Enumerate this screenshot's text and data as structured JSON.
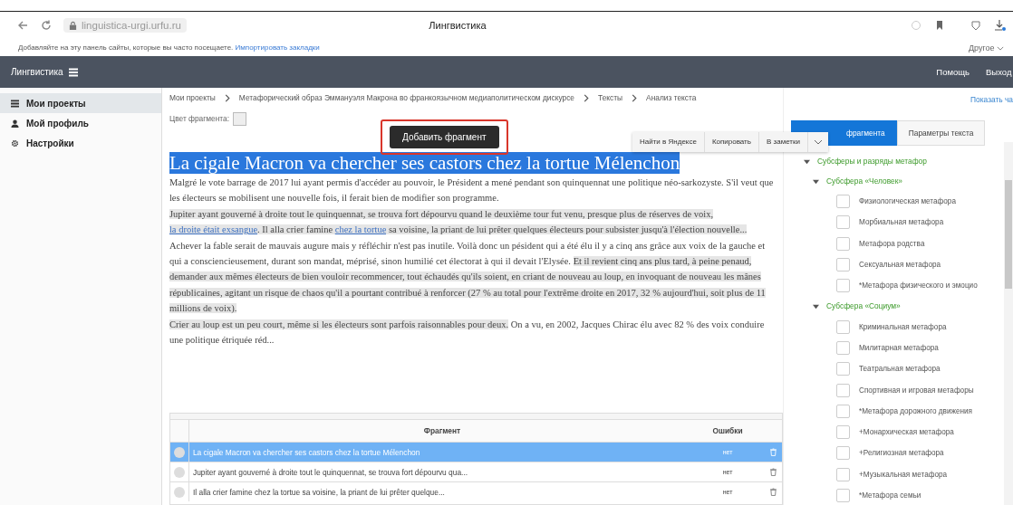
{
  "browser": {
    "url": "linguistica-urgi.urfu.ru",
    "title": "Лингвистика",
    "bookmarks_hint": "Добавляйте на эту панель сайты, которые вы часто посещаете.",
    "bookmarks_link": "Импортировать закладки",
    "other": "Другое"
  },
  "navbar": {
    "brand": "Лингвистика",
    "links": [
      "Помощь",
      "Выход"
    ]
  },
  "sidebar": {
    "items": [
      {
        "label": "Мои проекты",
        "kind": "list",
        "selected": true
      },
      {
        "label": "Мой профиль",
        "kind": "user",
        "selected": false
      },
      {
        "label": "Настройки",
        "kind": "gear",
        "selected": false
      }
    ]
  },
  "breadcrumbs": [
    "Мои проекты",
    "Метафорический образ Эммануэля Макрона во франкоязычном медиаполитическом дискурсе",
    "Тексты",
    "Анализ текста"
  ],
  "show_link": "Показать ча",
  "fragment_color_label": "Цвет фрагмента:",
  "tooltip": "Добавить фрагмент",
  "context_menu": [
    "Найти в Яндексе",
    "Копировать",
    "В заметки"
  ],
  "tabs": [
    {
      "label": "фрагмента",
      "selected": true
    },
    {
      "label": "Параметры текста",
      "selected": false
    }
  ],
  "document": {
    "title": "La cigale Macron va chercher ses castors chez la tortue Mélenchon",
    "title_selected": true,
    "paragraphs": [
      [
        {
          "text": "Malgré le vote barrage de 2017 lui ayant permis d'accéder au pouvoir, le Président a mené pendant son quinquennat une politique néo-sarkozyste. S'il veut que les électeurs se mobilisent une nouvelle fois, il ferait bien de modifier son programme.",
          "highlighted": false,
          "link": false
        }
      ],
      [
        {
          "text": "Jupiter ayant gouverné à droite tout le quinquennat, se trouva fort dépourvu quand le deuxième tour fut venu, presque plus de réserves de voix, ",
          "highlighted": true,
          "link": false
        },
        {
          "text": "la droite était exsangue",
          "highlighted": true,
          "link": true
        },
        {
          "text": ". Il alla crier famine ",
          "highlighted": true,
          "link": false
        },
        {
          "text": "chez la tortue",
          "highlighted": true,
          "link": true
        },
        {
          "text": " sa voisine, la priant de lui prêter quelques électeurs pour subsister jusqu'à l'élection nouvelle...",
          "highlighted": true,
          "link": false
        }
      ],
      [
        {
          "text": "Achever la fable serait de mauvais augure mais y réfléchir n'est pas inutile. Voilà donc un pésident qui a été élu il y a cinq ans grâce aux voix de la gauche et qui a consciencieusement, durant son mandat, méprisé, sinon humilié cet électorat à qui il devait l'Elysée. ",
          "highlighted": false,
          "link": false
        },
        {
          "text": "Et il revient cinq ans plus tard, à peine penaud, demander aux mêmes électeurs de bien vouloir recommencer, tout échaudés qu'ils soient, en criant de nouveau au loup, en invoquant de nouveau les mânes républicaines, agitant un risque de chaos qu'il a pourtant contribué à renforcer (27 % au total pour l'extrême droite en 2017, 32 % aujourd'hui, soit plus de 11 millions de voix).",
          "highlighted": true,
          "link": false
        }
      ],
      [
        {
          "text": "Crier au loup est un peu court, même si les électeurs sont parfois raisonnables pour deux.",
          "highlighted": true,
          "link": false
        },
        {
          "text": " On a vu, en 2002, Jacques Chirac élu avec 82 % des voix conduire une politique étriquée réd...",
          "highlighted": false,
          "link": false
        }
      ]
    ]
  },
  "table": {
    "columns": [
      "Фрагмент",
      "Ошибки"
    ],
    "rows": [
      {
        "fragment": "La cigale Macron va chercher ses castors chez la tortue Mélenchon",
        "errors": "нет",
        "selected": true
      },
      {
        "fragment": "Jupiter ayant gouverné à droite tout le quinquennat, se trouva fort dépourvu qua...",
        "errors": "нет",
        "selected": false
      },
      {
        "fragment": "Il alla crier famine chez la tortue sa voisine, la priant de lui prêter quelque...",
        "errors": "нет",
        "selected": false
      }
    ]
  },
  "tree": {
    "label": "Субсферы и разряды метафор",
    "expanded": true,
    "children": [
      {
        "label": "Субсфера «Человек»",
        "expanded": true,
        "children": [
          {
            "label": "Физиологическая метафора",
            "checked": false
          },
          {
            "label": "Морбиальная метафора",
            "checked": false
          },
          {
            "label": "Метафора родства",
            "checked": false
          },
          {
            "label": "Сексуальная метафора",
            "checked": false
          },
          {
            "label": "*Метафора физического и эмоцио",
            "checked": false
          }
        ]
      },
      {
        "label": "Субсфера «Социум»",
        "expanded": true,
        "children": [
          {
            "label": "Криминальная метафора",
            "checked": false
          },
          {
            "label": "Милитарная метафора",
            "checked": false
          },
          {
            "label": "Театральная метафора",
            "checked": false
          },
          {
            "label": "Спортивная и игровая метафоры",
            "checked": false
          },
          {
            "label": "*Метафора дорожного движения",
            "checked": false
          },
          {
            "label": "+Монархическая метафора",
            "checked": false
          },
          {
            "label": "+Религиозная метафора",
            "checked": false
          },
          {
            "label": "+Музыкальная метафора",
            "checked": false
          },
          {
            "label": "*Метафора семьи",
            "checked": false
          }
        ]
      }
    ]
  }
}
